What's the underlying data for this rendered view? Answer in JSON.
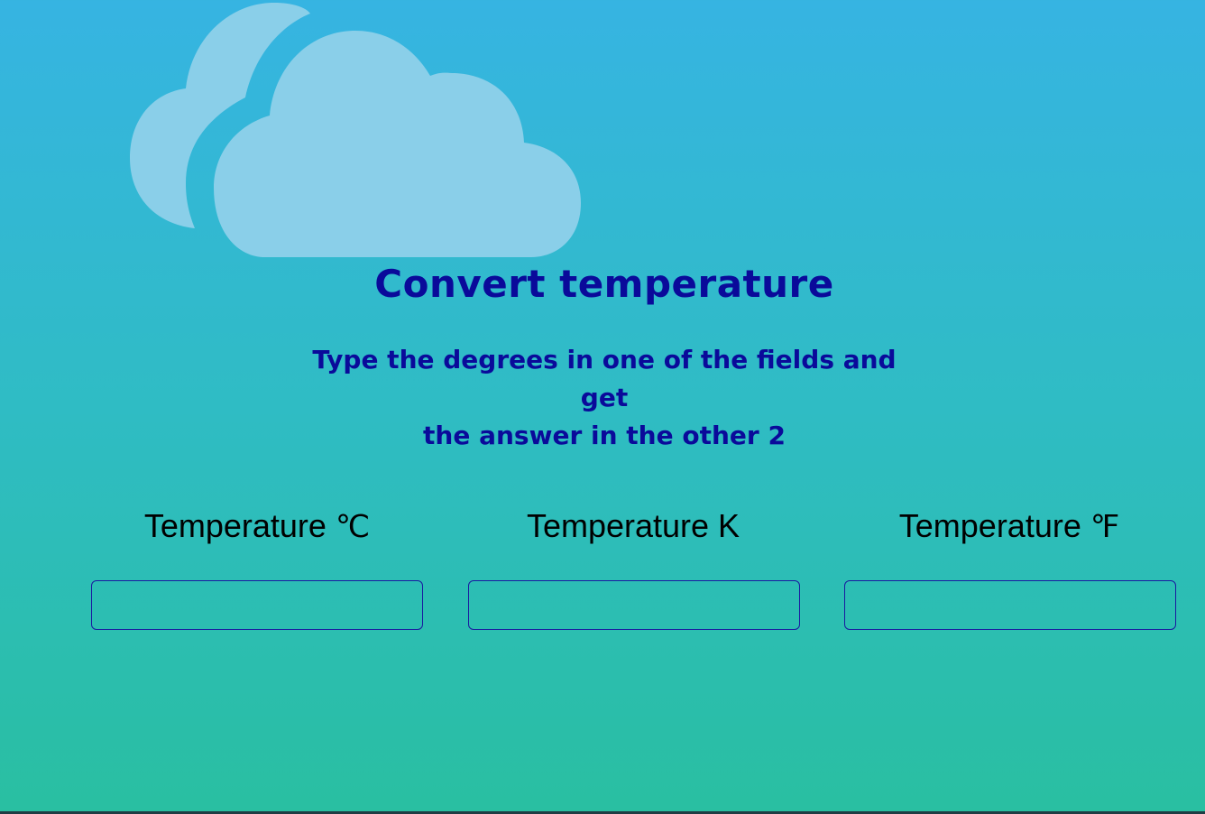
{
  "header": {
    "title": "Convert temperature",
    "subtitle_line1": "Type the degrees in one of the fields and get",
    "subtitle_line2": "the answer in the other 2",
    "logo_icon": "cloud-icon"
  },
  "fields": [
    {
      "label": "Temperature ",
      "unit": "℃",
      "value": "",
      "placeholder": ""
    },
    {
      "label": "Temperature K",
      "unit": "",
      "value": "",
      "placeholder": ""
    },
    {
      "label": "Temperature ",
      "unit": "℉",
      "value": "",
      "placeholder": ""
    }
  ],
  "colors": {
    "background_top": "#36b4e2",
    "background_bottom": "#29bfa1",
    "heading": "#0a0a9a",
    "cloud": "#8acfe9",
    "input_border": "#1a1aa0"
  }
}
